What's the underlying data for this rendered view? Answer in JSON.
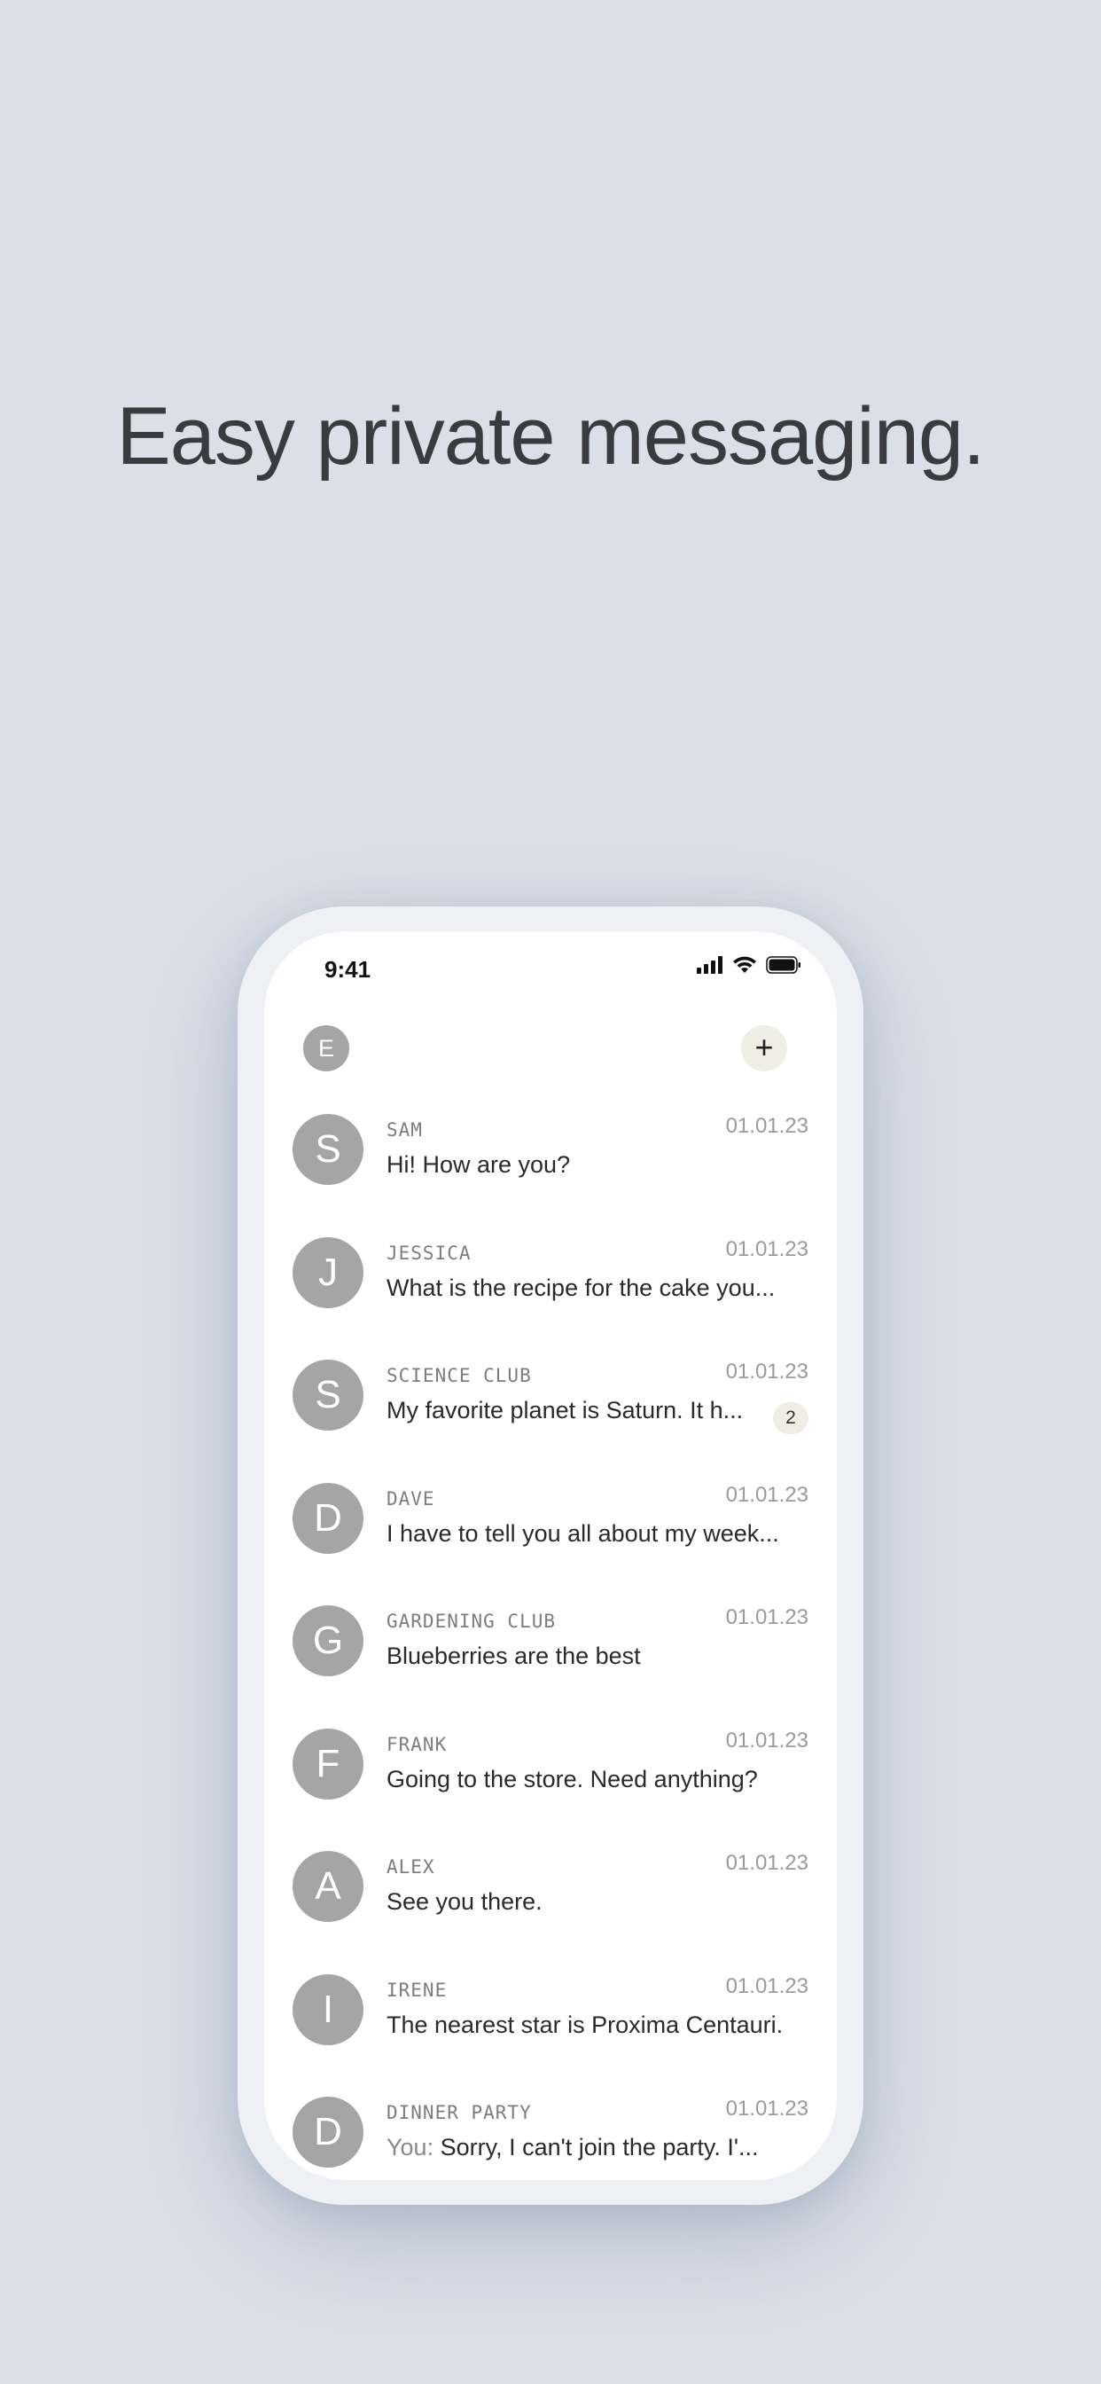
{
  "headline": "Easy private messaging.",
  "status_bar": {
    "time": "9:41",
    "icons": [
      "cellular-signal-icon",
      "wifi-icon",
      "battery-icon"
    ]
  },
  "topbar": {
    "profile_initial": "E",
    "new_message_label": "+"
  },
  "conversations": [
    {
      "initial": "S",
      "name": "SAM",
      "date": "01.01.23",
      "prefix": "",
      "preview": "Hi! How are you?",
      "unread": ""
    },
    {
      "initial": "J",
      "name": "JESSICA",
      "date": "01.01.23",
      "prefix": "",
      "preview": "What is the recipe for the cake you...",
      "unread": ""
    },
    {
      "initial": "S",
      "name": "SCIENCE CLUB",
      "date": "01.01.23",
      "prefix": "",
      "preview": "My favorite planet is Saturn. It h...",
      "unread": "2"
    },
    {
      "initial": "D",
      "name": "DAVE",
      "date": "01.01.23",
      "prefix": "",
      "preview": "I have to tell you all about my week...",
      "unread": ""
    },
    {
      "initial": "G",
      "name": "GARDENING CLUB",
      "date": "01.01.23",
      "prefix": "",
      "preview": "Blueberries are the best",
      "unread": ""
    },
    {
      "initial": "F",
      "name": "FRANK",
      "date": "01.01.23",
      "prefix": "",
      "preview": "Going to the store. Need anything?",
      "unread": ""
    },
    {
      "initial": "A",
      "name": "ALEX",
      "date": "01.01.23",
      "prefix": "",
      "preview": "See you there.",
      "unread": ""
    },
    {
      "initial": "I",
      "name": "IRENE",
      "date": "01.01.23",
      "prefix": "",
      "preview": "The nearest star is Proxima Centauri.",
      "unread": ""
    },
    {
      "initial": "D",
      "name": "DINNER PARTY",
      "date": "01.01.23",
      "prefix": "You:",
      "preview": "Sorry, I can't join the party. I'...",
      "unread": ""
    }
  ],
  "colors": {
    "background": "#dbe0e8",
    "avatar": "#a5a5a5",
    "accent_chip": "#efeee5",
    "headline": "#3a3b3f"
  }
}
